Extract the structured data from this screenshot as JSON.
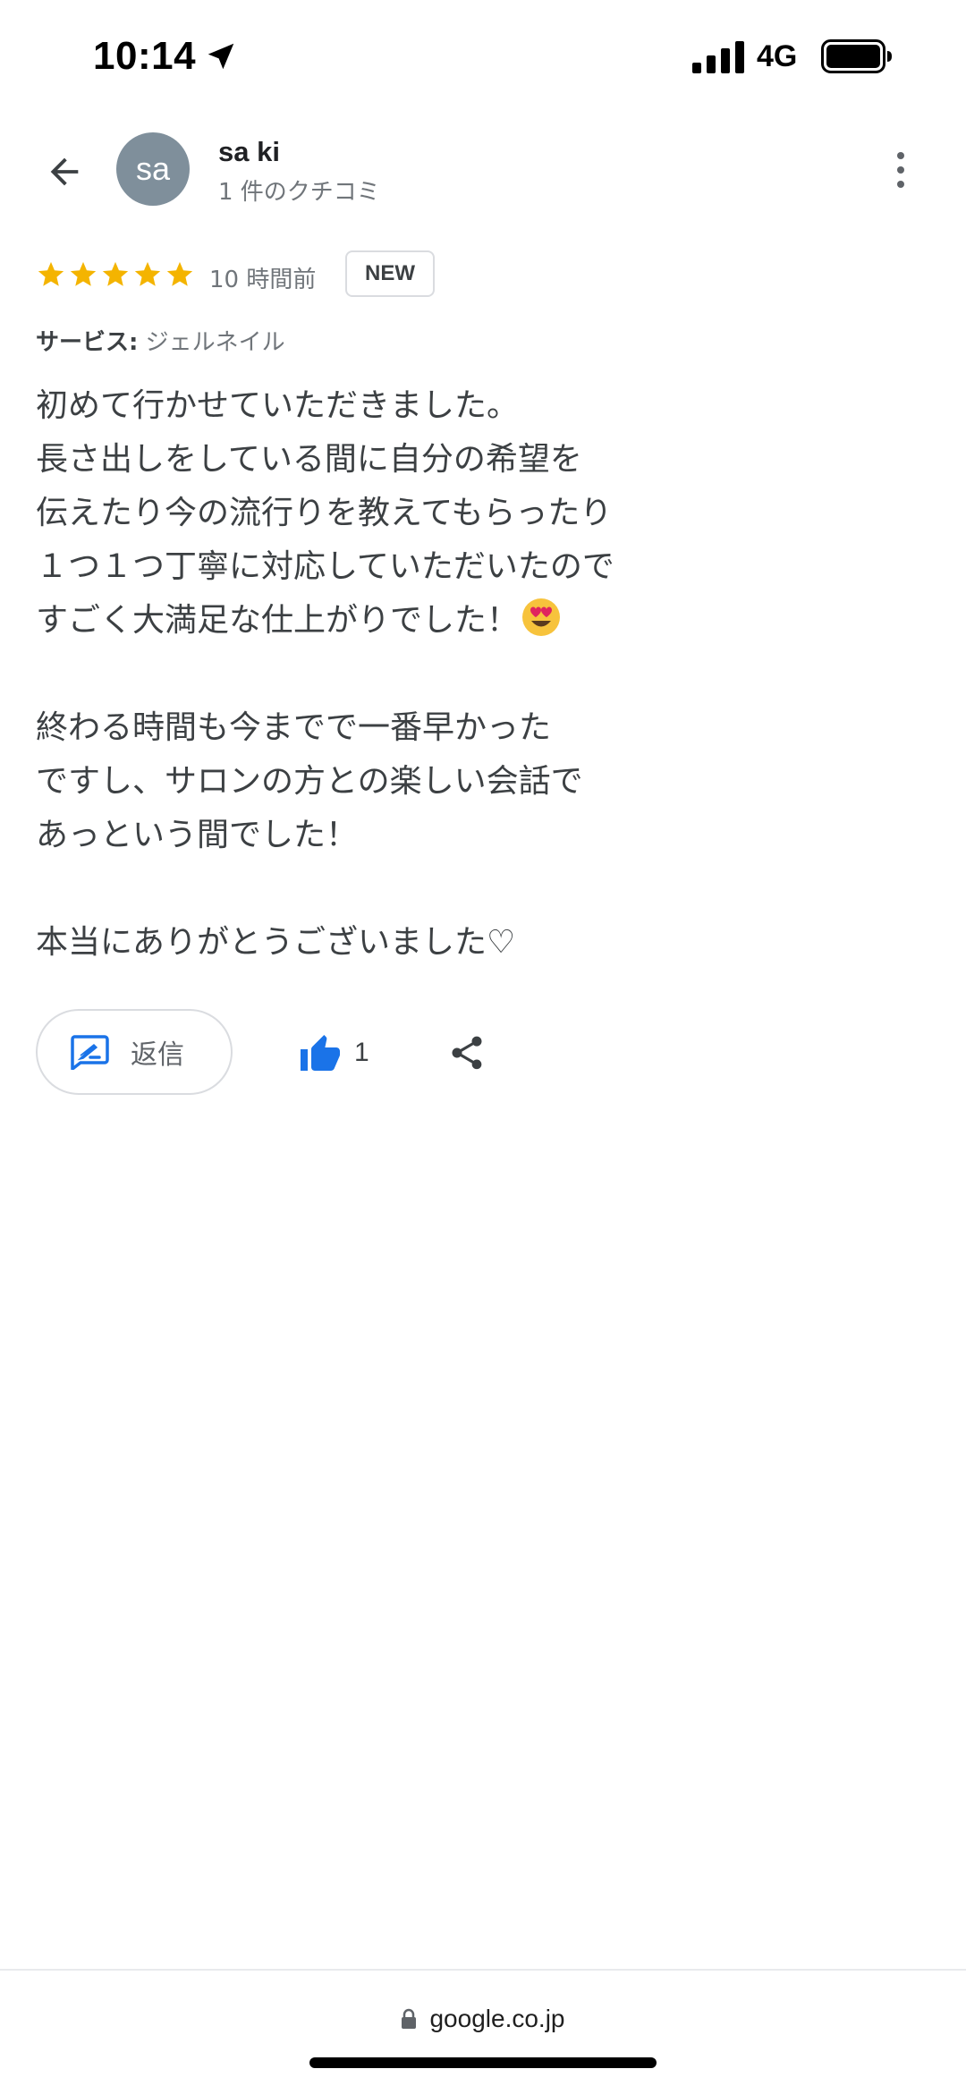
{
  "status_bar": {
    "time": "10:14",
    "network": "4G"
  },
  "header": {
    "avatar_initials": "sa",
    "reviewer_name": "sa ki",
    "review_count": "1 件のクチコミ"
  },
  "review": {
    "rating": 5,
    "rating_max": 5,
    "time_ago": "10 時間前",
    "badge": "NEW",
    "service_label": "サービス:",
    "service_value": "ジェルネイル",
    "paragraphs": [
      "初めて行かせていただきました。",
      "長さ出しをしている間に自分の希望を",
      "伝えたり今の流行りを教えてもらったり",
      "１つ１つ丁寧に対応していただいたので",
      "すごく大満足な仕上がりでした！",
      "終わる時間も今までで一番早かった",
      "ですし、サロンの方との楽しい会話で",
      "あっという間でした！",
      "本当にありがとうございました♡"
    ],
    "emoji": "smiling-face-with-heart-eyes"
  },
  "actions": {
    "reply_label": "返信",
    "like_count": "1"
  },
  "browser": {
    "url": "google.co.jp"
  },
  "colors": {
    "star": "#f4b400",
    "like": "#1a73e8",
    "reply_icon": "#1a73e8",
    "avatar_bg": "#7f8f9b"
  }
}
